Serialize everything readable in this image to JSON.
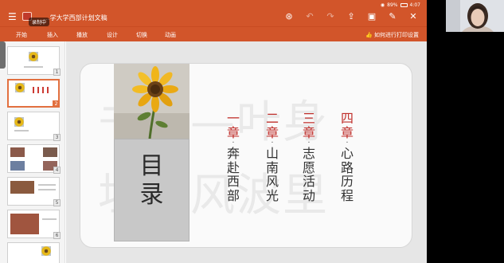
{
  "status_bar": {
    "battery": "89%",
    "time": "4:07"
  },
  "titlebar": {
    "document_title": "...学大学西部计划文稿",
    "recording_badge": "录制中",
    "menu_icon": "hamburger-menu-icon",
    "icons": [
      "record-icon",
      "undo-icon",
      "redo-icon",
      "share-icon",
      "slideshow-icon",
      "edit-icon",
      "close-icon"
    ]
  },
  "ribbon": {
    "tabs": [
      "开始",
      "插入",
      "播放",
      "设计",
      "切换",
      "动画"
    ],
    "help_link": "如何进行打印设置"
  },
  "thumbnails": {
    "numbers": [
      "1",
      "2",
      "3",
      "4",
      "5",
      "6",
      "7"
    ],
    "selected": "2"
  },
  "slide": {
    "watermark_line1": "书青—叶身",
    "watermark_line2": "坦设风波里",
    "toc_title_line1": "目",
    "toc_title_line2": "录",
    "chapters": [
      {
        "num": "一章",
        "sep": "·",
        "text": "奔赴西部"
      },
      {
        "num": "二章",
        "sep": "·",
        "text": "山南风光"
      },
      {
        "num": "三章",
        "sep": "·",
        "text": "志愿活动"
      },
      {
        "num": "四章",
        "sep": "·",
        "text": "心路历程"
      }
    ]
  },
  "colors": {
    "accent": "#d2552a",
    "chapter_number": "#c0302c",
    "toc_box": "#c8c8c8",
    "canvas": "#e6e6e6"
  }
}
